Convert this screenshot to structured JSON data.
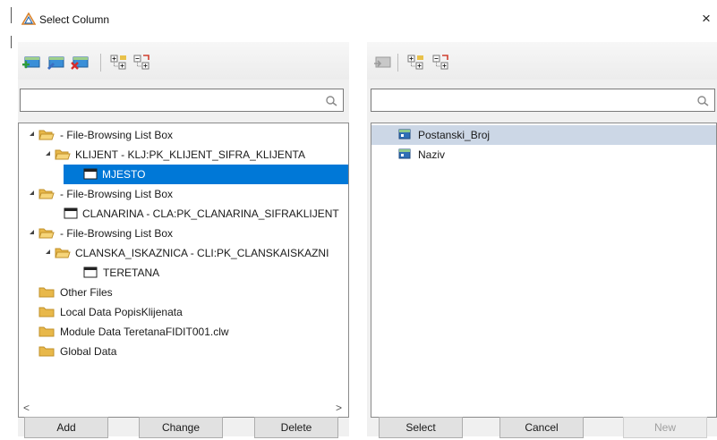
{
  "window": {
    "title": "Select Column",
    "close_glyph": "×"
  },
  "left_panel": {
    "toolbar_icons": [
      "add-column-icon",
      "change-column-icon",
      "delete-column-icon",
      "expand-all-icon",
      "collapse-all-icon"
    ],
    "search": {
      "value": "",
      "placeholder": ""
    },
    "tree": {
      "group1": "- File-Browsing List Box",
      "klijent": "KLIJENT - KLJ:PK_KLIJENT_SIFRA_KLIJENTA",
      "mjesto": "MJESTO",
      "group2": "- File-Browsing List Box",
      "clanarina": "CLANARINA - CLA:PK_CLANARINA_SIFRAKLIJENT",
      "group3": "- File-Browsing List Box",
      "clanska": "CLANSKA_ISKAZNICA - CLI:PK_CLANSKAISKAZNI",
      "teretana": "TERETANA",
      "other_files": "Other Files",
      "local_data": "Local Data PopisKlijenata",
      "module_data": "Module Data TeretanaFIDIT001.clw",
      "global_data": "Global Data"
    },
    "scroll": {
      "left": "<",
      "right": ">"
    }
  },
  "right_panel": {
    "toolbar_icons": [
      "select-column-icon",
      "expand-all-icon",
      "collapse-all-icon"
    ],
    "search": {
      "value": "",
      "placeholder": ""
    },
    "items": [
      "Postanski_Broj",
      "Naziv"
    ]
  },
  "buttons": {
    "add": "Add",
    "change": "Change",
    "delete": "Delete",
    "select": "Select",
    "cancel": "Cancel",
    "new": "New"
  },
  "colors": {
    "selection": "#0078d7",
    "highlight": "#ccd7e6",
    "folder": "#e8b84a"
  }
}
